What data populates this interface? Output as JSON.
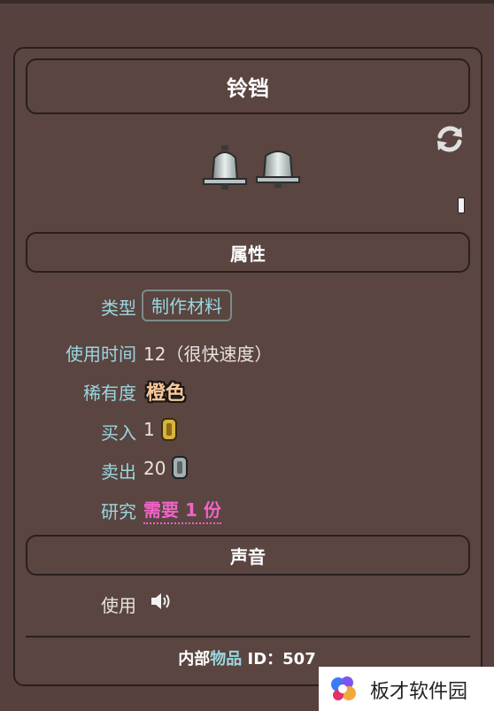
{
  "item": {
    "name": "铃铛"
  },
  "sections": {
    "attributes_title": "属性",
    "sound_title": "声音"
  },
  "attributes": {
    "type_label": "类型",
    "type_value": "制作材料",
    "use_time_label": "使用时间",
    "use_time_value": "12（很快速度）",
    "rarity_label": "稀有度",
    "rarity_value": "橙色",
    "buy_label": "买入",
    "buy_value": "1",
    "sell_label": "卖出",
    "sell_value": "20",
    "research_label": "研究",
    "research_value": "需要 1 份"
  },
  "sound": {
    "use_label": "使用"
  },
  "footer": {
    "prefix": "内部",
    "accent": "物品",
    "suffix": " ID：",
    "id_value": "507"
  },
  "watermark": {
    "text": "板才软件园"
  },
  "colors": {
    "background": "#56413e",
    "label": "#9ad6df",
    "rarity": "#f5c89a",
    "research": "#f063c8"
  },
  "icons": [
    "refresh-icon",
    "bell-icon",
    "gold-coin-icon",
    "silver-coin-icon",
    "speaker-icon"
  ]
}
